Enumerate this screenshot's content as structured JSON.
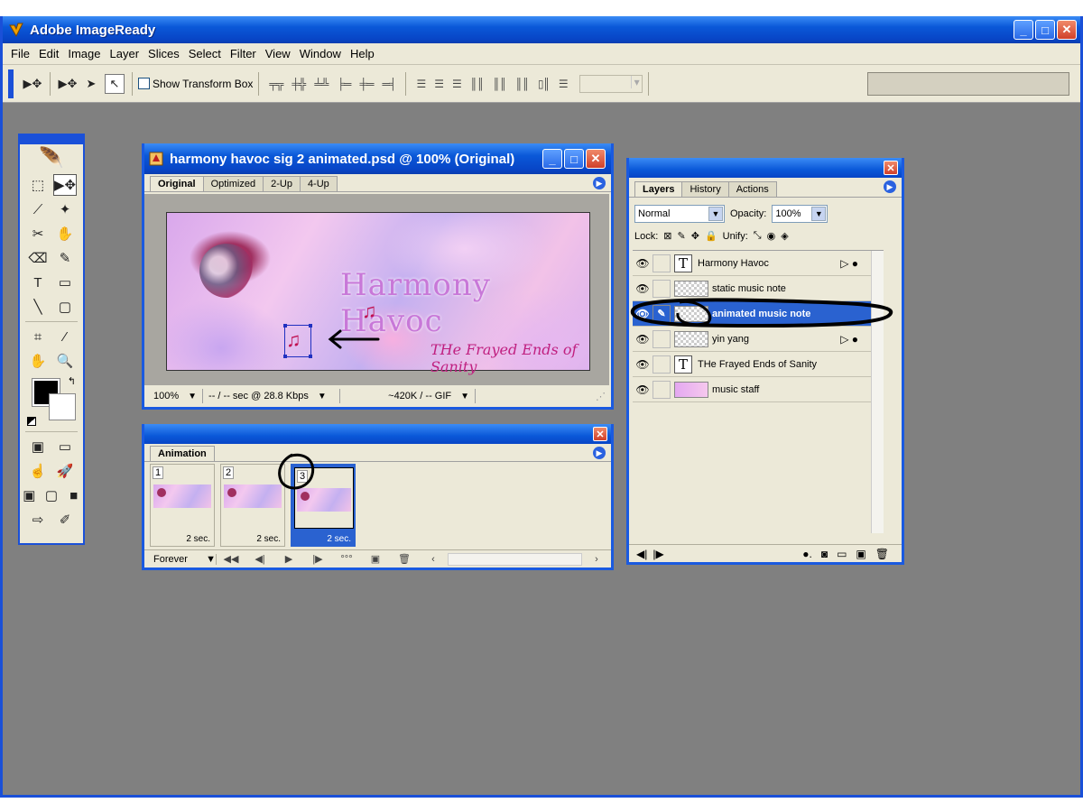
{
  "app": {
    "title": "Adobe ImageReady",
    "menus": [
      "File",
      "Edit",
      "Image",
      "Layer",
      "Slices",
      "Select",
      "Filter",
      "View",
      "Window",
      "Help"
    ]
  },
  "options_bar": {
    "show_transform_box_label": "Show Transform Box"
  },
  "document": {
    "title": "harmony havoc sig 2 animated.psd @ 100% (Original)",
    "tabs": [
      "Original",
      "Optimized",
      "2-Up",
      "4-Up"
    ],
    "active_tab": "Original",
    "artwork_title": "Harmony Havoc",
    "artwork_subtitle": "THe Frayed Ends of Sanity",
    "status": {
      "zoom": "100%",
      "download": "-- / -- sec @ 28.8 Kbps",
      "size": "~420K / -- GIF"
    }
  },
  "animation": {
    "tab": "Animation",
    "frames": [
      {
        "num": "1",
        "delay": "2 sec."
      },
      {
        "num": "2",
        "delay": "2 sec."
      },
      {
        "num": "3",
        "delay": "2 sec."
      }
    ],
    "loop": "Forever"
  },
  "layers_palette": {
    "tabs": [
      "Layers",
      "History",
      "Actions"
    ],
    "blend_mode": "Normal",
    "opacity_label": "Opacity:",
    "opacity": "100%",
    "lock_label": "Lock:",
    "unify_label": "Unify:",
    "layers": [
      {
        "name": "Harmony Havoc",
        "type": "text"
      },
      {
        "name": "static music note",
        "type": "raster"
      },
      {
        "name": "animated music note",
        "type": "raster"
      },
      {
        "name": "yin yang",
        "type": "raster"
      },
      {
        "name": "THe Frayed Ends of Sanity",
        "type": "text"
      },
      {
        "name": "music staff",
        "type": "raster"
      }
    ]
  },
  "colors": {
    "titlebar": "#0a58d8",
    "selection": "#2a62d0",
    "workspace": "#808080",
    "panel": "#ece9d8"
  }
}
